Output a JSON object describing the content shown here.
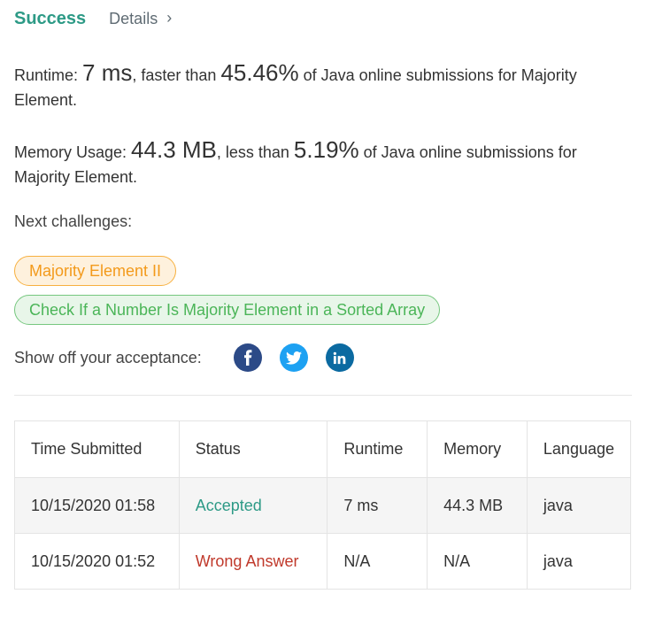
{
  "header": {
    "status_label": "Success",
    "details_label": "Details",
    "chevron": "›"
  },
  "runtime": {
    "prefix": "Runtime: ",
    "value": "7 ms",
    "middle": ", faster than ",
    "percent": "45.46%",
    "suffix": " of Java online submissions for Majority Element."
  },
  "memory": {
    "prefix": "Memory Usage: ",
    "value": "44.3 MB",
    "middle": ", less than ",
    "percent": "5.19%",
    "suffix": " of Java online submissions for Majority Element."
  },
  "next": {
    "label": "Next challenges:",
    "challenges": [
      {
        "label": "Majority Element II",
        "color": "#f39a1b"
      },
      {
        "label": "Check If a Number Is Majority Element in a Sorted Array",
        "color": "#4bb558"
      }
    ]
  },
  "share": {
    "label": "Show off your acceptance:",
    "icons": [
      {
        "name": "facebook-icon",
        "glyph": "f",
        "color": "#3b5998"
      },
      {
        "name": "twitter-icon",
        "glyph": "twitter",
        "color": "#1da1f2"
      },
      {
        "name": "linkedin-icon",
        "glyph": "in",
        "color": "#0e76a8"
      }
    ]
  },
  "submissions": {
    "columns": [
      "Time Submitted",
      "Status",
      "Runtime",
      "Memory",
      "Language"
    ],
    "rows": [
      {
        "time": "10/15/2020 01:58",
        "status": "Accepted",
        "runtime": "7 ms",
        "memory": "44.3 MB",
        "language": "java"
      },
      {
        "time": "10/15/2020 01:52",
        "status": "Wrong Answer",
        "runtime": "N/A",
        "memory": "N/A",
        "language": "java"
      }
    ]
  },
  "colors": {
    "success": "#2d9a86",
    "accepted": "#2d9a86",
    "wrong_answer": "#c0392b"
  }
}
